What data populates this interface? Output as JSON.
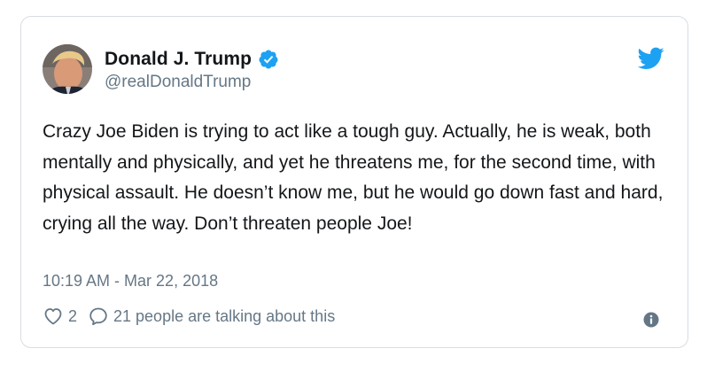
{
  "tweet": {
    "display_name": "Donald J. Trump",
    "handle": "@realDonaldTrump",
    "text": "Crazy Joe Biden is trying to act like a tough guy. Actually, he is weak, both mentally and physically, and yet he threatens me, for the second time, with physical assault. He doesn’t know me, but he would go down fast and hard, crying all the way. Don’t threaten people Joe!",
    "timestamp": "10:19 AM - Mar 22, 2018",
    "likes": "2",
    "conversation": "21 people are talking about this"
  },
  "icons": {
    "verified": "verified-badge-icon",
    "brand": "twitter-bird-icon",
    "like": "heart-icon",
    "reply": "speech-bubble-icon",
    "info": "info-icon"
  },
  "colors": {
    "brand_blue": "#1da1f2",
    "text": "#14171a",
    "secondary": "#657786",
    "border": "#d7dde2"
  }
}
